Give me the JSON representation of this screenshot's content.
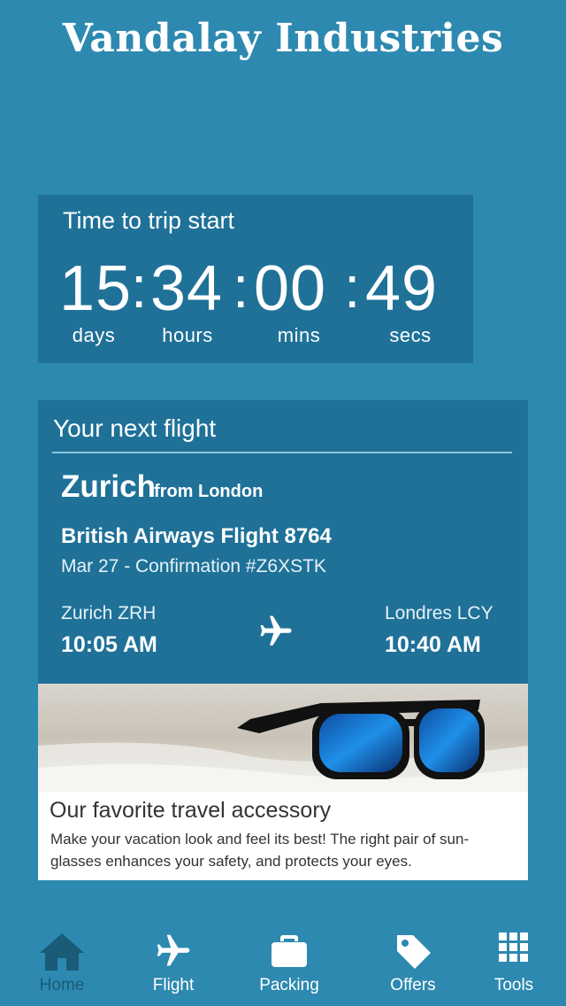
{
  "app": {
    "title": "Vandalay Industries"
  },
  "countdown": {
    "label": "Time to trip start",
    "days": "15",
    "hours": "34",
    "mins": "00",
    "secs": "49",
    "units": {
      "days": "days",
      "hours": "hours",
      "mins": "mins",
      "secs": "secs"
    }
  },
  "flight": {
    "heading": "Your next flight",
    "destination": "Zurich",
    "from": "from London",
    "airline": "British Airways Flight 8764",
    "confirmation": "Mar 27 - Confirmation #Z6XSTK",
    "departure": {
      "code": "Zurich ZRH",
      "time": "10:05 AM"
    },
    "arrival": {
      "code": "Londres LCY",
      "time": "10:40 AM"
    },
    "icon": "airplane-icon"
  },
  "promo": {
    "title": "Our favorite travel accessory",
    "text": "Make your vacation look and feel its best! The right pair of sun-glasses enhances your safety, and protects your eyes.",
    "image": "sunglasses-on-beach-image"
  },
  "nav": {
    "items": [
      {
        "label": "Home",
        "icon": "home-icon",
        "active": true
      },
      {
        "label": "Flight",
        "icon": "airplane-icon",
        "active": false
      },
      {
        "label": "Packing",
        "icon": "suitcase-icon",
        "active": false
      },
      {
        "label": "Offers",
        "icon": "tag-icon",
        "active": false
      },
      {
        "label": "Tools",
        "icon": "grid-icon",
        "active": false
      }
    ]
  },
  "colors": {
    "background": "#2d89b0",
    "card": "#1f7198",
    "active_nav": "#1a5b78",
    "white": "#ffffff"
  }
}
